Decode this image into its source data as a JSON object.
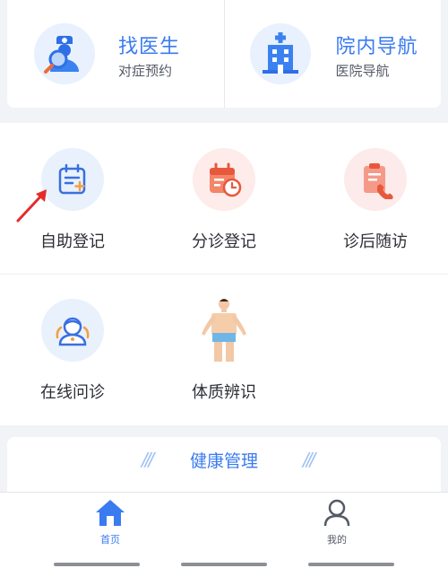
{
  "quick_access": [
    {
      "title": "找医生",
      "subtitle": "对症预约",
      "icon": "doctor-search-icon"
    },
    {
      "title": "院内导航",
      "subtitle": "医院导航",
      "icon": "hospital-building-icon"
    }
  ],
  "services": [
    {
      "label": "自助登记",
      "icon": "self-registration-icon"
    },
    {
      "label": "分诊登记",
      "icon": "triage-calendar-icon"
    },
    {
      "label": "诊后随访",
      "icon": "followup-phone-icon"
    },
    {
      "label": "在线问诊",
      "icon": "online-consult-doctor-icon"
    },
    {
      "label": "体质辨识",
      "icon": "body-figure-icon"
    }
  ],
  "health_section": {
    "title": "健康管理"
  },
  "tabbar": {
    "items": [
      {
        "label": "首页",
        "icon": "home-icon",
        "active": true
      },
      {
        "label": "我的",
        "icon": "profile-icon",
        "active": false
      }
    ]
  },
  "colors": {
    "accent": "#3a7bf0",
    "annotation_arrow": "#e52b2b"
  }
}
